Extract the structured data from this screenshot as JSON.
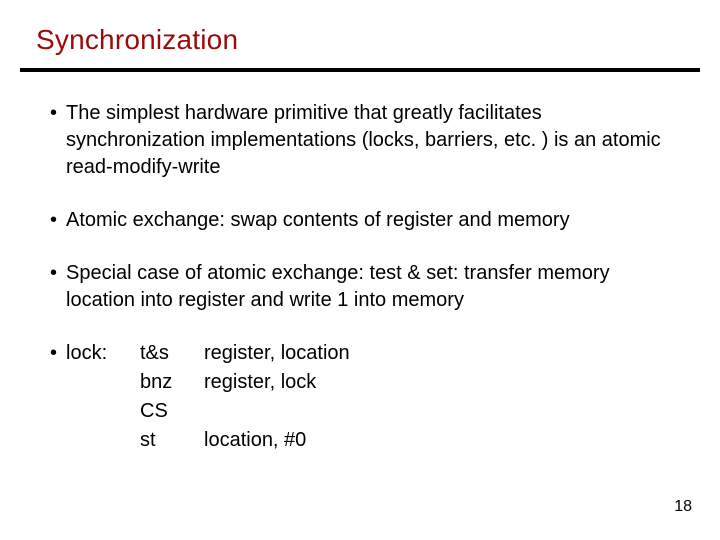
{
  "title": "Synchronization",
  "bullets": {
    "b1": "The simplest hardware primitive that greatly facilitates synchronization implementations (locks, barriers, etc. ) is an atomic read-modify-write",
    "b2": "Atomic exchange: swap contents of register and memory",
    "b3": "Special case of atomic exchange: test & set: transfer memory location into register and write 1 into memory"
  },
  "lock": {
    "label": "lock:",
    "rows": [
      {
        "op": "t&s",
        "args": "register, location"
      },
      {
        "op": "bnz",
        "args": "register, lock"
      },
      {
        "op": "CS",
        "args": ""
      },
      {
        "op": "st",
        "args": "location, #0"
      }
    ]
  },
  "glyphs": {
    "bullet": "•"
  },
  "page": "18"
}
